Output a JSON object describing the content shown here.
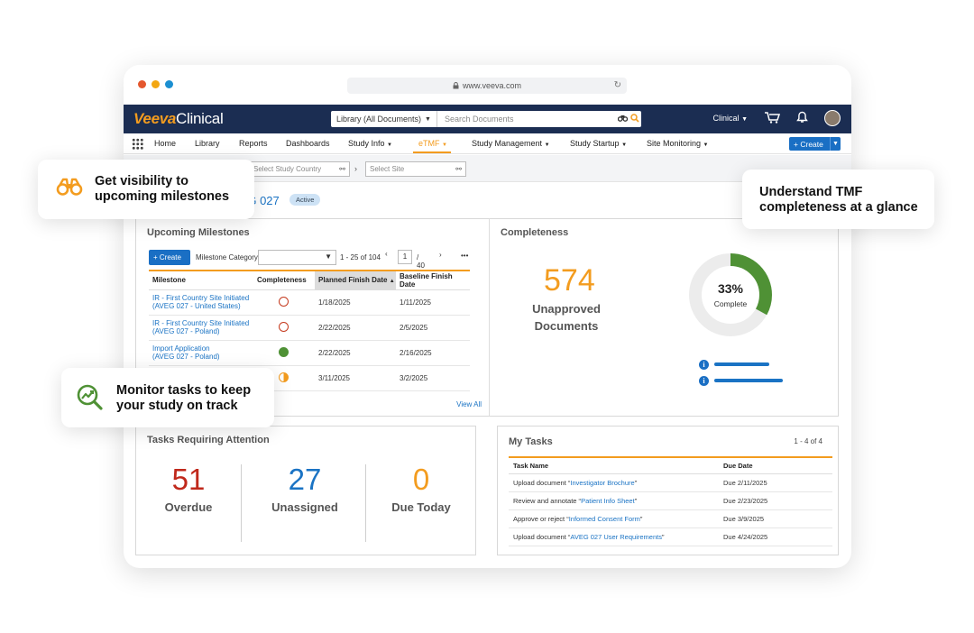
{
  "browser": {
    "url": "www.veeva.com",
    "dot_colors": [
      "#e4572e",
      "#f3a712",
      "#1b8fd1"
    ]
  },
  "app": {
    "brand_main": "Veeva",
    "brand_sub": "Clinical",
    "search_scope": "Library (All Documents)",
    "search_placeholder": "Search Documents",
    "workspace": "Clinical",
    "accent": "#f39c1f",
    "navy": "#1b2d52",
    "blue": "#1a6fc4"
  },
  "nav": {
    "home": "Home",
    "library": "Library",
    "reports": "Reports",
    "dashboards": "Dashboards",
    "study_info": "Study Info",
    "etmf": "eTMF",
    "study_management": "Study Management",
    "study_startup": "Study Startup",
    "site_monitoring": "Site Monitoring",
    "create": "Create"
  },
  "filters": {
    "country_placeholder": "Select Study Country",
    "site_placeholder": "Select Site"
  },
  "study": {
    "name": "VEG 027",
    "status": "Active"
  },
  "milestones": {
    "title": "Upcoming Milestones",
    "create": "Create",
    "category_label": "Milestone Category:",
    "range": "1 - 25 of 104",
    "page": "1",
    "page_total": "/  40",
    "more": "•••",
    "headers": [
      "Milestone",
      "Completeness",
      "Planned Finish Date",
      "Baseline Finish Date"
    ],
    "rows": [
      {
        "l1": "IR - First Country Site Initiated",
        "l2": "(AVEG 027 - United States)",
        "status": "open",
        "planned": "1/18/2025",
        "baseline": "1/11/2025"
      },
      {
        "l1": "IR - First Country Site Initiated",
        "l2": "(AVEG 027 - Poland)",
        "status": "open",
        "planned": "2/22/2025",
        "baseline": "2/5/2025"
      },
      {
        "l1": "Import Application",
        "l2": "(AVEG 027 - Poland)",
        "status": "done",
        "planned": "2/22/2025",
        "baseline": "2/16/2025"
      },
      {
        "l1": "",
        "l2": "",
        "status": "half",
        "planned": "3/11/2025",
        "baseline": "3/2/2025"
      }
    ],
    "view_all": "View All"
  },
  "completeness": {
    "title": "Completeness",
    "number": "574",
    "label_line1": "Unapproved",
    "label_line2": "Documents",
    "percent_text": "33%",
    "percent_value": 33,
    "complete_label": "Complete",
    "info_glyph": "i"
  },
  "tasks_attention": {
    "title": "Tasks Requiring Attention",
    "overdue": {
      "value": "51",
      "label": "Overdue",
      "color": "#c0281b"
    },
    "unassigned": {
      "value": "27",
      "label": "Unassigned",
      "color": "#1a73c4"
    },
    "due_today": {
      "value": "0",
      "label": "Due Today",
      "color": "#f39c1f"
    }
  },
  "my_tasks": {
    "title": "My Tasks",
    "range": "1 - 4 of 4",
    "headers": [
      "Task Name",
      "Due Date"
    ],
    "rows": [
      {
        "prefix": "Upload document “",
        "doc": "Investigator Brochure",
        "suffix": "”",
        "due": "Due 2/11/2025"
      },
      {
        "prefix": "Review and annotate “",
        "doc": "Patient Info Sheet",
        "suffix": "”",
        "due": "Due 2/23/2025"
      },
      {
        "prefix": "Approve or reject “",
        "doc": "Informed Consent Form",
        "suffix": "”",
        "due": "Due 3/9/2025"
      },
      {
        "prefix": "Upload document “",
        "doc": "AVEG 027 User Requirements",
        "suffix": "”",
        "due": "Due 4/24/2025"
      }
    ]
  },
  "callouts": {
    "milestones_l1": "Get visibility to",
    "milestones_l2": "upcoming milestones",
    "tmf_l1": "Understand TMF",
    "tmf_l2": "completeness at a glance",
    "tasks_l1": "Monitor tasks to keep",
    "tasks_l2": "your study on track"
  }
}
